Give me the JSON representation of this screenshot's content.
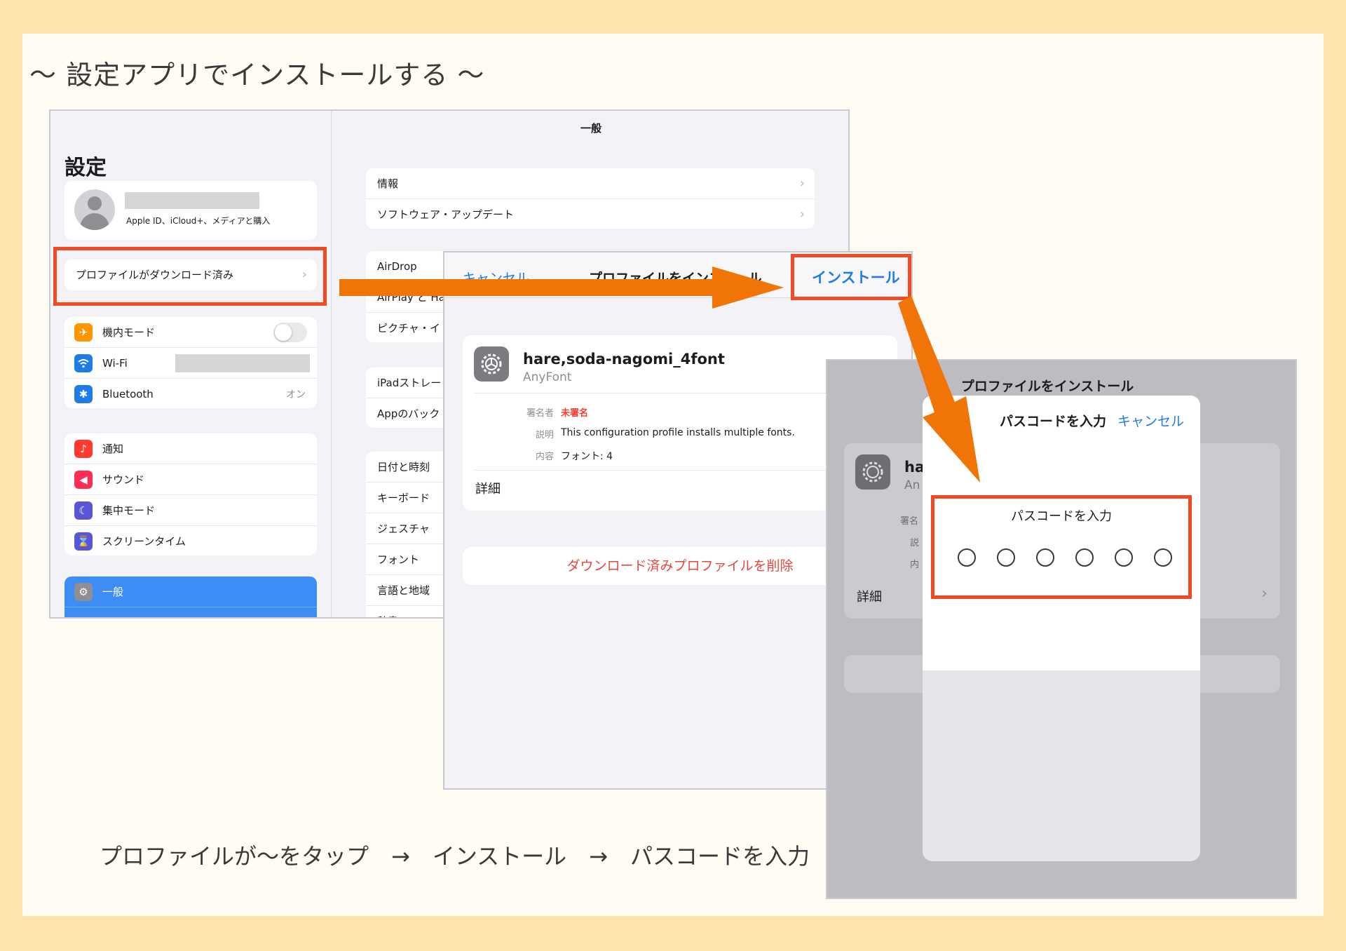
{
  "heading": "〜 設定アプリでインストールする 〜",
  "caption": "プロファイルが〜をタップ　→　インストール　→　パスコードを入力",
  "colors": {
    "highlight": "#ef4a23",
    "arrow": "#f07406",
    "link": "#1f7ce6",
    "destructive": "#e8463c"
  },
  "settings": {
    "title": "設定",
    "account_sub": "Apple ID、iCloud+、メディアと購入",
    "profile_downloaded": "プロファイルがダウンロード済み",
    "group1": [
      {
        "label": "機内モード",
        "icon": "airplane-icon"
      },
      {
        "label": "Wi-Fi",
        "icon": "wifi-icon"
      },
      {
        "label": "Bluetooth",
        "icon": "bluetooth-icon",
        "value": "オン"
      }
    ],
    "group2": [
      {
        "label": "通知",
        "icon": "bell-icon"
      },
      {
        "label": "サウンド",
        "icon": "speaker-icon"
      },
      {
        "label": "集中モード",
        "icon": "moon-icon"
      },
      {
        "label": "スクリーンタイム",
        "icon": "hourglass-icon"
      }
    ],
    "general": "一般"
  },
  "general_pane": {
    "title": "一般",
    "group1": [
      "情報",
      "ソフトウェア・アップデート"
    ],
    "group2": [
      "AirDrop",
      "AirPlay と Han",
      "ピクチャ・イ"
    ],
    "group3": [
      "iPadストレー",
      "Appのバック"
    ],
    "group4": [
      "日付と時刻",
      "キーボード",
      "ジェスチャ",
      "フォント",
      "言語と地域",
      "辞書"
    ]
  },
  "install_profile": {
    "cancel": "キャンセル",
    "title": "プロファイルをインストール",
    "install": "インストール",
    "profile_name": "hare,soda-nagomi_4font",
    "profile_org": "AnyFont",
    "signed_by_label": "署名者",
    "signed_by_value": "未署名",
    "description_label": "説明",
    "description_value": "This configuration profile installs multiple fonts.",
    "contents_label": "内容",
    "contents_value": "フォント: 4",
    "more_details": "詳細",
    "delete": "ダウンロード済みプロファイルを削除"
  },
  "passcode": {
    "bg_title": "プロファイルをインストール",
    "bg_name": "ha",
    "bg_org": "An",
    "bg_signed": "署名",
    "bg_desc": "説",
    "bg_contents": "内",
    "bg_details": "詳細",
    "sheet_title": "パスコードを入力",
    "cancel": "キャンセル",
    "prompt": "パスコードを入力",
    "digits": 6
  }
}
